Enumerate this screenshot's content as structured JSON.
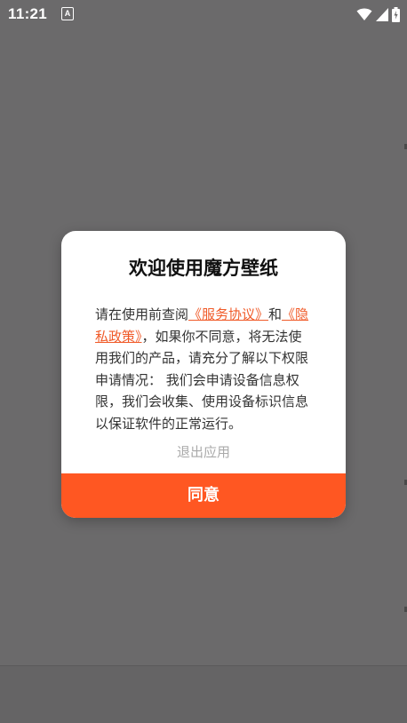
{
  "status_bar": {
    "time": "11:21",
    "notification_label": "A"
  },
  "dialog": {
    "title": "欢迎使用魔方壁纸",
    "body_prefix": "请在使用前查阅",
    "service_link": "《服务协议》",
    "body_and": "和",
    "privacy_link": "《隐私政策》",
    "body_rest": "，如果你不同意，将无法使用我们的产品，请充分了解以下权限申请情况： 我们会申请设备信息权限，我们会收集、使用设备标识信息以保证软件的正常运行。",
    "exit_label": "退出应用",
    "agree_label": "同意"
  },
  "colors": {
    "overlay": "#6b6a6b",
    "accent": "#ff5722",
    "link": "#f05a28",
    "muted_text": "#aaaaaa"
  },
  "icons": [
    "wifi-icon",
    "signal-icon",
    "battery-icon"
  ]
}
